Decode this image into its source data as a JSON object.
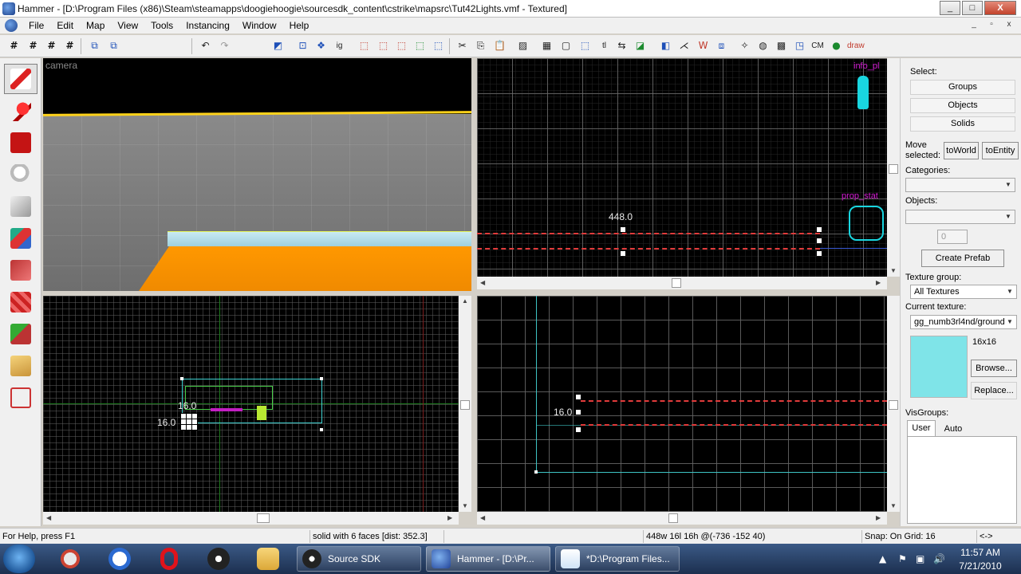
{
  "window": {
    "title": "Hammer - [D:\\Program Files (x86)\\Steam\\steamapps\\doogiehoogie\\sourcesdk_content\\cstrike\\mapsrc\\Tut42Lights.vmf - Textured]",
    "min": "_",
    "max": "□",
    "close": "X"
  },
  "menu": {
    "items": [
      "File",
      "Edit",
      "Map",
      "View",
      "Tools",
      "Instancing",
      "Window",
      "Help"
    ],
    "mdi": [
      "_",
      "▫",
      "x"
    ]
  },
  "toolbar": {
    "icons": [
      "grid-icon",
      "grid-icon",
      "grid-icon",
      "grid-icon",
      "group-icon",
      "ungroup-icon",
      "undo-icon",
      "redo-icon",
      "carve-icon",
      "hide-icon",
      "texture-lock-icon",
      "ig-icon",
      "cut-icon",
      "copy-icon",
      "paste-icon",
      "texture-app-icon",
      "select-icon",
      "run-icon",
      "cordon-icon",
      "cm-icon",
      "draw-icon"
    ],
    "labels": {
      "ig": "ig",
      "cm": "CM",
      "draw": "draw",
      "tl": "tl"
    }
  },
  "tools": [
    "selection-tool",
    "magnify-tool",
    "camera-tool",
    "entity-tool",
    "block-tool",
    "texture-tool",
    "apply-decal-tool",
    "overlay-tool",
    "clipping-tool",
    "vertex-tool"
  ],
  "viewports": {
    "camera_label": "camera",
    "top_right_measure": "448.0",
    "bottom_left_measure_1": "16.0",
    "bottom_left_measure_2": "16.0",
    "bottom_right_measure": "16.0",
    "top_right_entity_labels": [
      "info_pl",
      "prop_stat"
    ]
  },
  "panel": {
    "select_label": "Select:",
    "groups": "Groups",
    "objects": "Objects",
    "solids": "Solids",
    "move_selected": "Move selected:",
    "to_world": "toWorld",
    "to_entity": "toEntity",
    "categories_label": "Categories:",
    "objects_label": "Objects:",
    "spinner_value": "0",
    "create_prefab": "Create Prefab",
    "texture_group_label": "Texture group:",
    "texture_group_value": "All Textures",
    "current_texture_label": "Current texture:",
    "current_texture_value": "gg_numb3rl4nd/ground",
    "texture_size": "16x16",
    "texture_color": "#7fe4e8",
    "browse": "Browse...",
    "replace": "Replace...",
    "visgroups_label": "VisGroups:",
    "tab_user": "User",
    "tab_auto": "Auto"
  },
  "status": {
    "help": "For Help, press F1",
    "selection": "solid with 6 faces  [dist: 352.3]",
    "size": "448w 16l 16h @(-736 -152 40)",
    "snap": "Snap: On Grid: 16",
    "arrows": "<->"
  },
  "taskbar": {
    "tasks": [
      "Source SDK",
      "Hammer - [D:\\Pr...",
      "*D:\\Program Files..."
    ],
    "time": "11:57 AM",
    "date": "7/21/2010"
  }
}
